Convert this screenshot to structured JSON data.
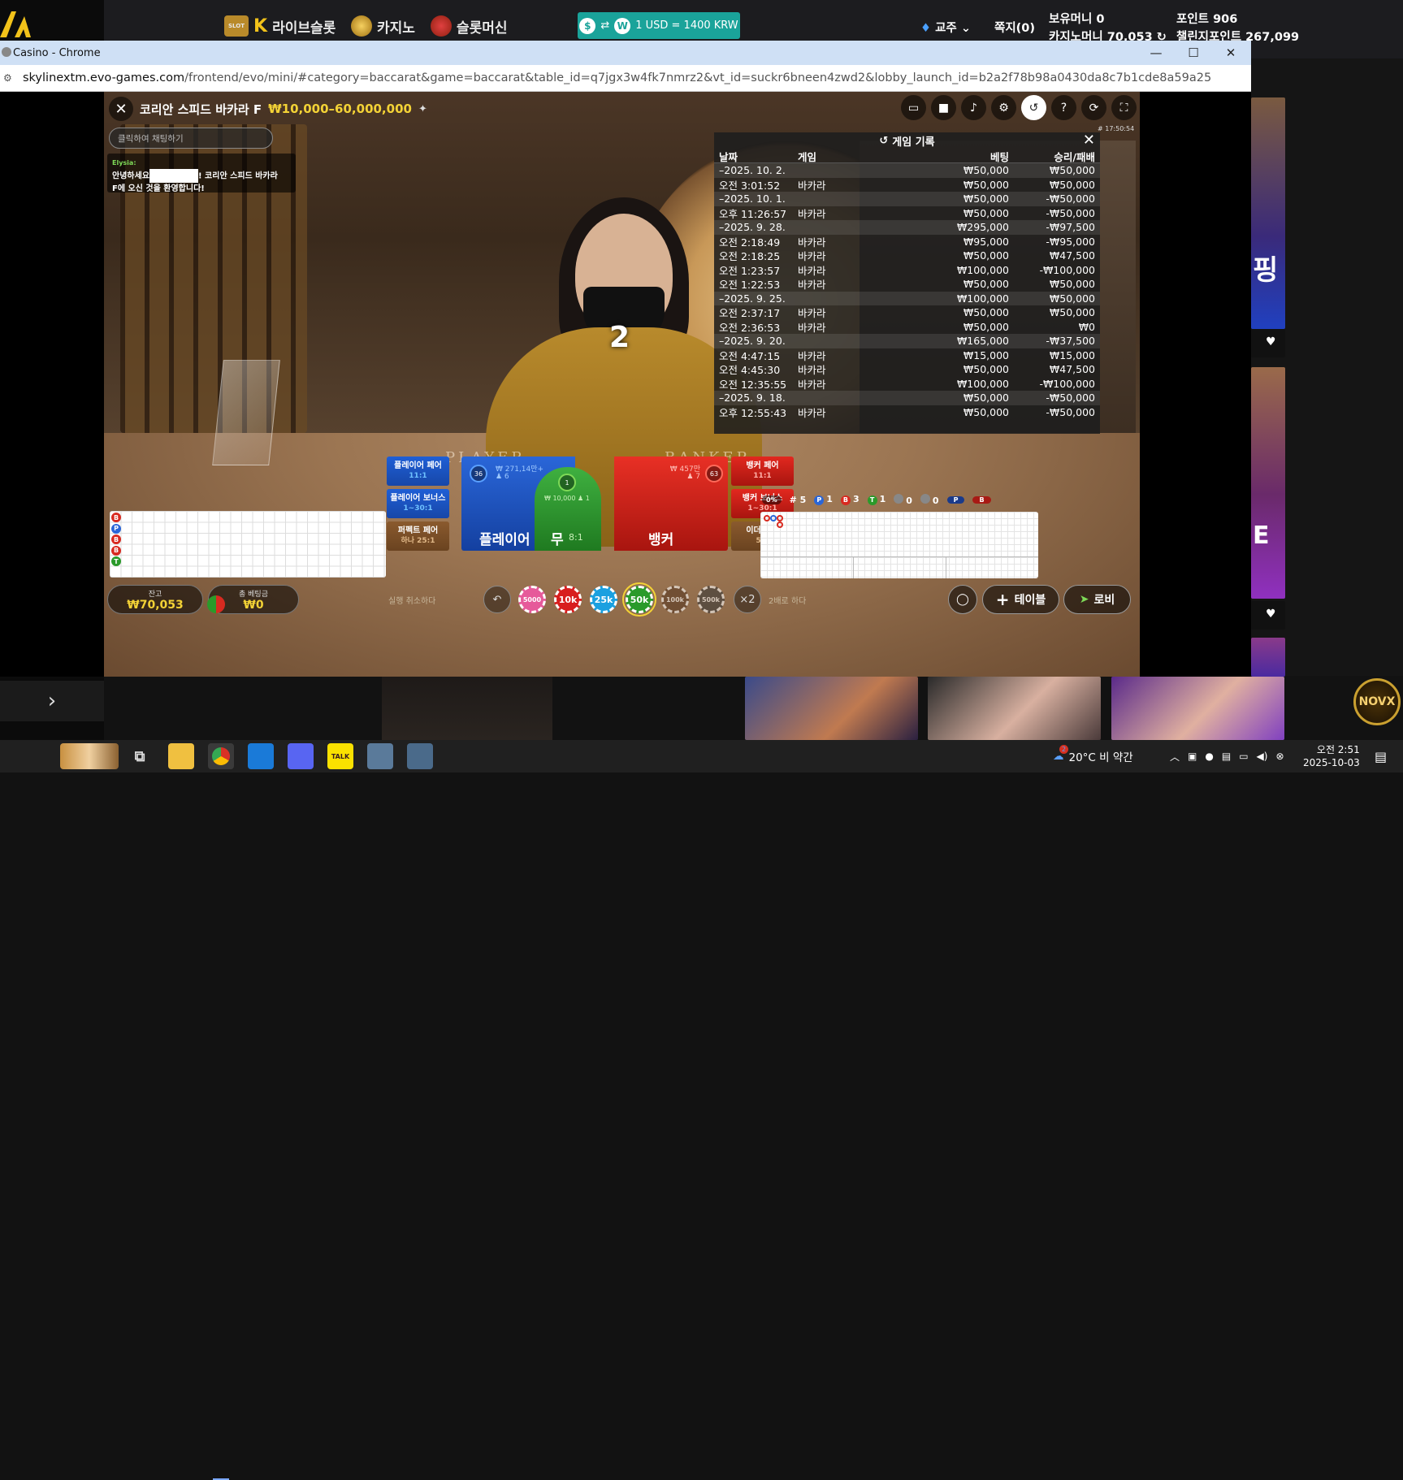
{
  "site": {
    "nav": [
      {
        "label": "라이브슬롯",
        "icon": "slot-icon"
      },
      {
        "label": "카지노",
        "icon": "casino-icon"
      },
      {
        "label": "슬롯머신",
        "icon": "slot-machine-icon"
      }
    ],
    "slot_badge": "SLOT",
    "exchange": "1 USD = 1400 KRW",
    "exchange_left": "$",
    "exchange_right": "W",
    "user": "교주",
    "messages": "쪽지(0)",
    "holding_money": "보유머니 0",
    "casino_money": "카지노머니 70,053",
    "points": "포인트 906",
    "challenge_points": "챌린지포인트 267,099",
    "promo_text": "핑",
    "promo_text2": "E",
    "novx_logo": "NOVX"
  },
  "chrome": {
    "title": "Casino - Chrome",
    "url_host": "skylinextm.evo-games.com",
    "url_rest": "/frontend/evo/mini/#category=baccarat&game=baccarat&table_id=q7jgx3w4fk7nmrz2&vt_id=suckr6bneen4zwd2&lobby_launch_id=b2a2f78b98a0430da8c7b1cde8a59a25"
  },
  "game": {
    "table_name": "코리안 스피드 바카라 F",
    "limits": "₩10,000–60,000,000",
    "chat_placeholder": "클릭하여 채팅하기",
    "chat_user": "Elysia:",
    "chat_prefix": "안녕하세요",
    "chat_suffix": "! 코리안 스피드 바카라",
    "chat_line2": "F에 오신 것을 환영합니다!",
    "clock": "# 17:50:54",
    "countdown": "2",
    "felt_player": "PLAYER",
    "felt_banker": "BANKER"
  },
  "history": {
    "title": "게임 기록",
    "cols": [
      "날짜",
      "게임",
      "베팅",
      "승리/패배"
    ],
    "rows": [
      {
        "date": "–2025. 10. 2.",
        "game": "",
        "bet": "₩50,000",
        "result": "₩50,000",
        "is_date": true
      },
      {
        "date": "오전 3:01:52",
        "game": "바카라",
        "bet": "₩50,000",
        "result": "₩50,000",
        "is_date": false
      },
      {
        "date": "–2025. 10. 1.",
        "game": "",
        "bet": "₩50,000",
        "result": "-₩50,000",
        "is_date": true
      },
      {
        "date": "오후 11:26:57",
        "game": "바카라",
        "bet": "₩50,000",
        "result": "-₩50,000",
        "is_date": false
      },
      {
        "date": "–2025. 9. 28.",
        "game": "",
        "bet": "₩295,000",
        "result": "-₩97,500",
        "is_date": true
      },
      {
        "date": "오전 2:18:49",
        "game": "바카라",
        "bet": "₩95,000",
        "result": "-₩95,000",
        "is_date": false
      },
      {
        "date": "오전 2:18:25",
        "game": "바카라",
        "bet": "₩50,000",
        "result": "₩47,500",
        "is_date": false
      },
      {
        "date": "오전 1:23:57",
        "game": "바카라",
        "bet": "₩100,000",
        "result": "-₩100,000",
        "is_date": false
      },
      {
        "date": "오전 1:22:53",
        "game": "바카라",
        "bet": "₩50,000",
        "result": "₩50,000",
        "is_date": false
      },
      {
        "date": "–2025. 9. 25.",
        "game": "",
        "bet": "₩100,000",
        "result": "₩50,000",
        "is_date": true
      },
      {
        "date": "오전 2:37:17",
        "game": "바카라",
        "bet": "₩50,000",
        "result": "₩50,000",
        "is_date": false
      },
      {
        "date": "오전 2:36:53",
        "game": "바카라",
        "bet": "₩50,000",
        "result": "₩0",
        "is_date": false
      },
      {
        "date": "–2025. 9. 20.",
        "game": "",
        "bet": "₩165,000",
        "result": "-₩37,500",
        "is_date": true
      },
      {
        "date": "오전 4:47:15",
        "game": "바카라",
        "bet": "₩15,000",
        "result": "₩15,000",
        "is_date": false
      },
      {
        "date": "오전 4:45:30",
        "game": "바카라",
        "bet": "₩50,000",
        "result": "₩47,500",
        "is_date": false
      },
      {
        "date": "오전 12:35:55",
        "game": "바카라",
        "bet": "₩100,000",
        "result": "-₩100,000",
        "is_date": false
      },
      {
        "date": "–2025. 9. 18.",
        "game": "",
        "bet": "₩50,000",
        "result": "-₩50,000",
        "is_date": true
      },
      {
        "date": "오후 12:55:43",
        "game": "바카라",
        "bet": "₩50,000",
        "result": "-₩50,000",
        "is_date": false
      }
    ]
  },
  "bets": {
    "player_pair": "플레이어 페어",
    "player_pair_odds": "11:1",
    "player_bonus": "플레이어 보너스",
    "player_bonus_odds": "1~30:1",
    "perfect_pair": "퍼펙트 페어",
    "perfect_pair_odds": "하나 25:1",
    "banker_pair": "뱅커 페어",
    "banker_pair_odds": "11:1",
    "banker_bonus": "뱅커 보너스",
    "banker_bonus_odds": "1~30:1",
    "either_pair": "이더 페어",
    "either_pair_odds": "5:1",
    "player": "플레이어",
    "player_amount": "₩ 271,14만+",
    "player_count": "♟ 6",
    "player_pct": "36",
    "tie": "무",
    "tie_odds": "8:1",
    "tie_amount": "₩ 10,000 ♟ 1",
    "tie_pct": "1",
    "banker": "뱅커",
    "banker_amount": "₩ 457만",
    "banker_count": "♟ 7",
    "banker_pct": "63"
  },
  "stats": {
    "zero_pct": "0%",
    "round": "# 5",
    "p_count": "1",
    "b_count": "3",
    "t_count": "1",
    "pp_count": "0",
    "bp_count": "0",
    "p_label": "P",
    "b_label": "B",
    "t_label": "T"
  },
  "bead_road": [
    "B",
    "P",
    "B",
    "B",
    "T"
  ],
  "bottom": {
    "balance_label": "잔고",
    "balance": "₩70,053",
    "total_bet_label": "총 베팅금",
    "total_bet": "₩0",
    "undo": "실행 취소하다",
    "double": "2배로 하다",
    "double_btn": "×2",
    "chips": [
      {
        "label": "5000",
        "color": "#e65a9a"
      },
      {
        "label": "10k",
        "color": "#d81e1e"
      },
      {
        "label": "25k",
        "color": "#1aa0e0"
      },
      {
        "label": "50k",
        "color": "#2a9a2a"
      },
      {
        "label": "100k",
        "color": "#5a3a24"
      },
      {
        "label": "500k",
        "color": "#3a3a3a"
      }
    ],
    "table_btn": "테이블",
    "lobby_btn": "로비"
  },
  "taskbar": {
    "weather": "20°C  비 약간",
    "time": "오전 2:51",
    "date": "2025-10-03",
    "notif_count": "2",
    "talk": "TALK"
  }
}
